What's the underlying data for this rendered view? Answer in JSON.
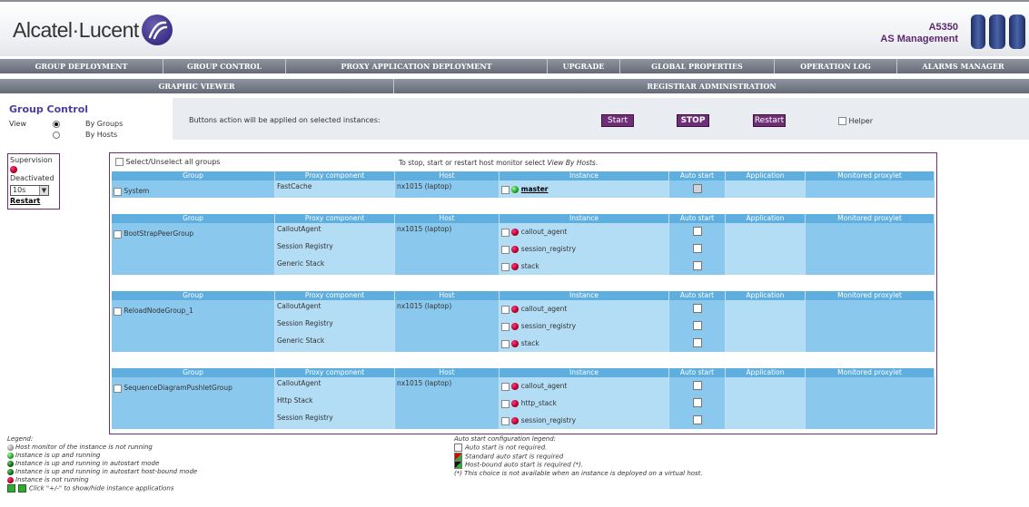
{
  "header": {
    "brand": "Alcatel·Lucent",
    "product_line1": "A5350",
    "product_line2": "AS Management"
  },
  "nav_primary": [
    "GROUP DEPLOYMENT",
    "GROUP CONTROL",
    "PROXY APPLICATION DEPLOYMENT",
    "UPGRADE",
    "GLOBAL PROPERTIES",
    "OPERATION LOG",
    "ALARMS MANAGER"
  ],
  "nav_secondary": [
    "GRAPHIC VIEWER",
    "REGISTRAR ADMINISTRATION"
  ],
  "group_control": {
    "title": "Group Control",
    "view_label": "View",
    "by_groups": "By Groups",
    "by_hosts": "By Hosts",
    "selected_view": "By Groups"
  },
  "actions": {
    "text": "Buttons action will be applied on selected instances:",
    "start": "Start",
    "stop": "STOP",
    "restart": "Restart",
    "helper": "Helper"
  },
  "supervision": {
    "title": "Supervision",
    "status": "Deactivated",
    "interval": "10s",
    "restart": "Restart"
  },
  "table": {
    "select_all": "Select/Unselect all groups",
    "hint_prefix": "To stop, start or restart host monitor select",
    "hint_link": "View By Hosts",
    "hint_suffix": ".",
    "columns": [
      "Group",
      "Proxy component",
      "Host",
      "Instance",
      "Auto start",
      "Application",
      "Monitored proxylet"
    ],
    "groups": [
      {
        "name": "System",
        "rows": [
          {
            "component": "FastCache",
            "host": "nx1015 (laptop)",
            "instance": "master",
            "state": "green",
            "link": true,
            "auto_disabled": true
          }
        ]
      },
      {
        "name": "BootStrapPeerGroup",
        "rows": [
          {
            "component": "CalloutAgent",
            "host": "nx1015 (laptop)",
            "instance": "callout_agent",
            "state": "red"
          },
          {
            "component": "Session Registry",
            "host": "",
            "instance": "session_registry",
            "state": "red"
          },
          {
            "component": "Generic Stack",
            "host": "",
            "instance": "stack",
            "state": "red"
          }
        ]
      },
      {
        "name": "ReloadNodeGroup_1",
        "rows": [
          {
            "component": "CalloutAgent",
            "host": "nx1015 (laptop)",
            "instance": "callout_agent",
            "state": "red"
          },
          {
            "component": "Session Registry",
            "host": "",
            "instance": "session_registry",
            "state": "red"
          },
          {
            "component": "Generic Stack",
            "host": "",
            "instance": "stack",
            "state": "red"
          }
        ]
      },
      {
        "name": "SequenceDiagramPushletGroup",
        "rows": [
          {
            "component": "CalloutAgent",
            "host": "nx1015 (laptop)",
            "instance": "callout_agent",
            "state": "red"
          },
          {
            "component": "Http Stack",
            "host": "",
            "instance": "http_stack",
            "state": "red"
          },
          {
            "component": "Session Registry",
            "host": "",
            "instance": "session_registry",
            "state": "red"
          }
        ]
      }
    ]
  },
  "legend": {
    "title": "Legend:",
    "items": [
      {
        "color": "gray",
        "text": "Host monitor of the instance is not running"
      },
      {
        "color": "green",
        "text": "Instance is up and running"
      },
      {
        "color": "dkgreen",
        "text": "Instance is up and running in autostart mode"
      },
      {
        "color": "dkgreen",
        "text": "Instance is up and running in autostart host-bound mode"
      },
      {
        "color": "red",
        "text": "Instance is not running"
      }
    ],
    "toggle_text": "Click \"+/-\" to show/hide instance applications"
  },
  "autostart_legend": {
    "title": "Auto start configuration legend:",
    "items": [
      "Auto start is not required.",
      "Standard auto start is required",
      "Host-bound auto start is required (*)."
    ],
    "note": "(*) This choice is not available when an instance is deployed on a virtual host."
  }
}
